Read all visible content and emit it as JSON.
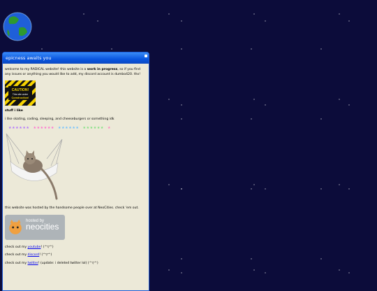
{
  "window": {
    "title": "epicness awaits you"
  },
  "intro": {
    "pre": "welcome to my RADICAL website! this website is a ",
    "bold": "work in progress",
    "post": ", so if you find any issues or anything you would like to add, my discord account is dumbo420. thx!"
  },
  "caution_sign": {
    "line1": "CAUTION!",
    "line2": "This site under",
    "line3": "Construction!"
  },
  "stuff_heading": "stuff i like",
  "stuff_text": "i like skating, coding, sleeping, and cheeseburgers or something idk",
  "stars_rows": [
    "★★★★★★",
    "★★★★★★",
    "★★★★★★",
    "★★★★★★",
    "★"
  ],
  "hosting": {
    "text": "this website was hosted by the handsome people over at NeoCities. check 'em out.",
    "badge_small": "hosted by",
    "badge_big": "neocities"
  },
  "links": [
    {
      "pre": "check out my ",
      "link": "youtube",
      "post": "! (^▽^)"
    },
    {
      "pre": "check out my ",
      "link": "discord",
      "post": "! (^▽^)"
    },
    {
      "pre": "check out my ",
      "link": "twitter",
      "post": "! (update: i deleted twitter lol) (^▽^)"
    }
  ],
  "colors": {
    "titlebar": "#0a56e0",
    "panel_bg": "#ece9d8",
    "space": "#0c0c3a"
  }
}
